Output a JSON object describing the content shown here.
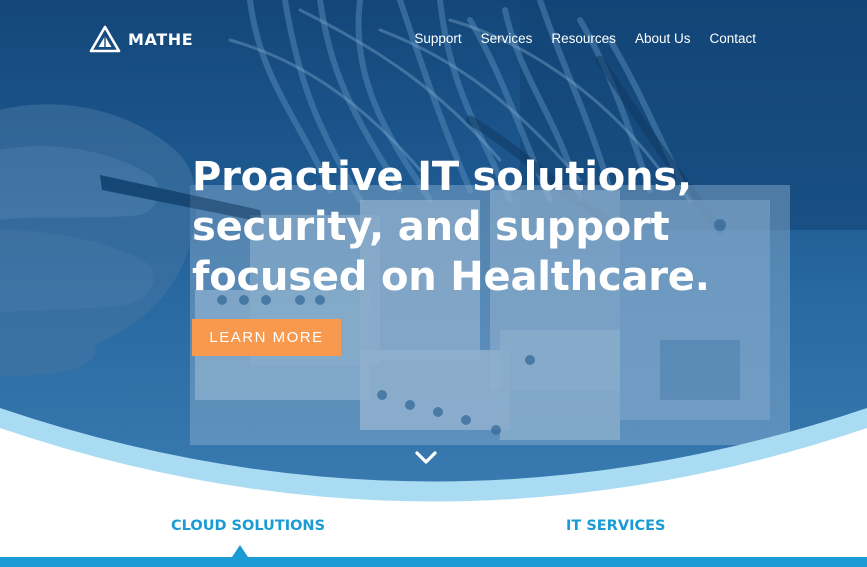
{
  "brand": {
    "name": "MATHE",
    "logo_icon": "triangle-mountain-logo"
  },
  "nav": {
    "items": [
      {
        "label": "Support"
      },
      {
        "label": "Services"
      },
      {
        "label": "Resources"
      },
      {
        "label": "About Us"
      },
      {
        "label": "Contact"
      }
    ]
  },
  "hero": {
    "headline_lines": [
      "Proactive IT solutions,",
      "security, and support",
      "focused on Healthcare."
    ],
    "cta_label": "LEARN MORE",
    "scroll_icon": "chevron-down-icon"
  },
  "tabs": [
    {
      "label": "CLOUD SOLUTIONS",
      "active": true
    },
    {
      "label": "IT SERVICES",
      "active": false
    }
  ],
  "colors": {
    "hero_overlay": "#1e5a90",
    "cta": "#f79a4f",
    "accent": "#1a9bd3",
    "wave_light": "#a9dcf2",
    "text_on_dark": "#ffffff"
  }
}
